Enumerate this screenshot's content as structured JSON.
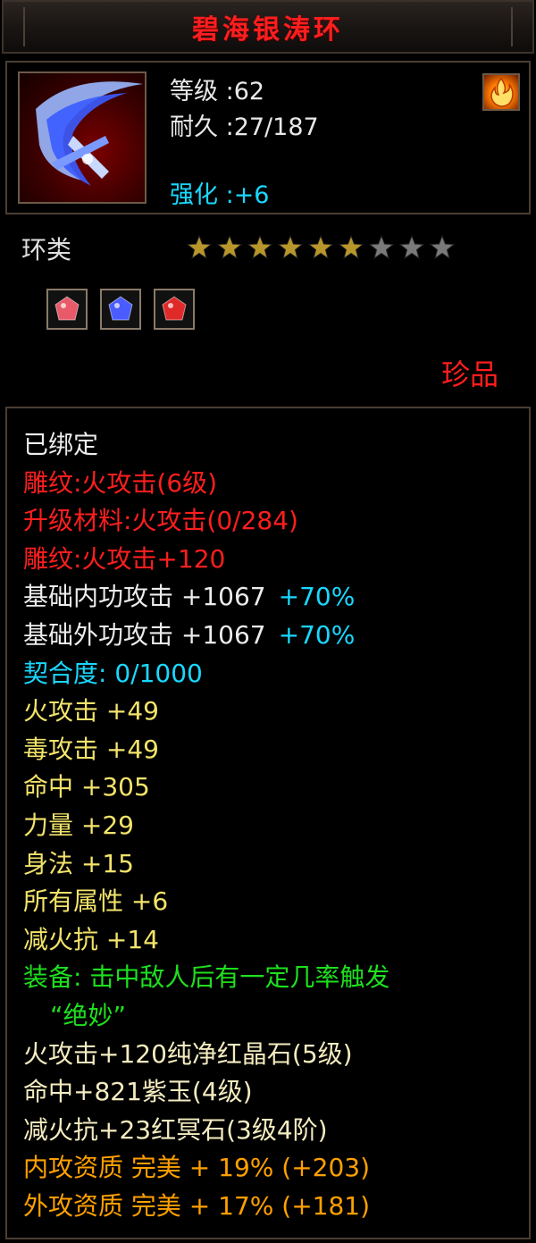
{
  "title": "碧海银涛环",
  "item": {
    "level_label": "等级",
    "level_value": "62",
    "durability_label": "耐久",
    "durability_value": "27/187",
    "enhance_label": "强化",
    "enhance_value": "+6",
    "icon": "blade-ring-icon",
    "side_icon": "fire-icon"
  },
  "type": "环类",
  "stars": {
    "filled": 6,
    "total": 9,
    "filled_color": "#b8962a",
    "empty_color": "#7a7a7a"
  },
  "gems": [
    {
      "icon": "pink-gem-icon",
      "color": "#e85a6a"
    },
    {
      "icon": "blue-gem-icon",
      "color": "#4a5cff"
    },
    {
      "icon": "red-gem-icon",
      "color": "#e02a2a"
    }
  ],
  "rarity": "珍品",
  "attributes": [
    {
      "text": "已绑定",
      "color": "c-white"
    },
    {
      "text": "雕纹:火攻击(6级)",
      "color": "c-red"
    },
    {
      "text": "升级材料:火攻击(0/284)",
      "color": "c-red"
    },
    {
      "text": "雕纹:火攻击+120",
      "color": "c-red"
    },
    {
      "text": "基础内功攻击 +1067",
      "extra": "+70%",
      "color": "c-white"
    },
    {
      "text": "基础外功攻击 +1067",
      "extra": "+70%",
      "color": "c-white"
    },
    {
      "text": "契合度: 0/1000",
      "color": "c-cyan"
    },
    {
      "text": "火攻击 +49",
      "color": "c-yellow"
    },
    {
      "text": "毒攻击 +49",
      "color": "c-yellow"
    },
    {
      "text": "命中 +305",
      "color": "c-yellow"
    },
    {
      "text": "力量 +29",
      "color": "c-yellow"
    },
    {
      "text": "身法 +15",
      "color": "c-yellow"
    },
    {
      "text": "所有属性 +6",
      "color": "c-yellow"
    },
    {
      "text": "减火抗 +14",
      "color": "c-yellow"
    },
    {
      "text": "装备: 击中敌人后有一定几率触发",
      "color": "c-green"
    },
    {
      "text": "“绝妙”",
      "color": "c-green",
      "indent": true
    },
    {
      "text": "火攻击+120纯净红晶石(5级)",
      "color": "c-pale"
    },
    {
      "text": "命中+821紫玉(4级)",
      "color": "c-pale"
    },
    {
      "text": "减火抗+23红冥石(3级4阶)",
      "color": "c-pale"
    },
    {
      "text": "内攻资质 完美 + 19% (+203)",
      "color": "c-orange"
    },
    {
      "text": "外攻资质 完美 + 17% (+181)",
      "color": "c-orange"
    }
  ]
}
